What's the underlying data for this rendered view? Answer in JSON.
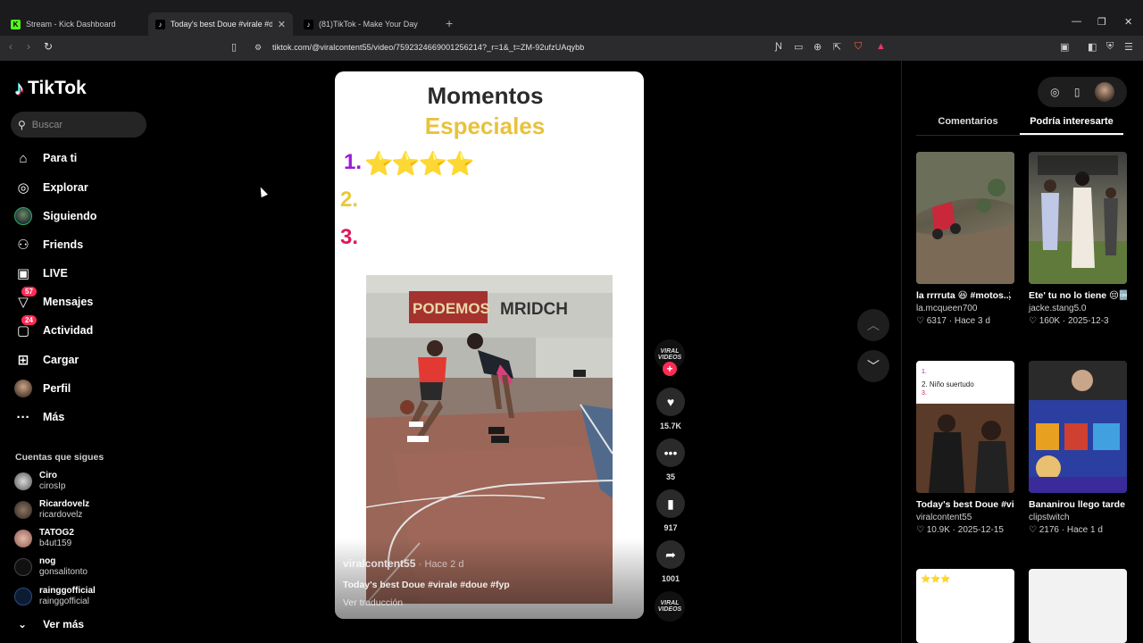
{
  "browser": {
    "tabs": [
      {
        "label": "Stream - Kick Dashboard",
        "icon": "K"
      },
      {
        "label": "Today's best Doue #virale #doue",
        "icon": "♪"
      },
      {
        "label": "(81)TikTok - Make Your Day",
        "icon": "♪"
      }
    ],
    "url": "tiktok.com/@viralcontent55/video/7592324669001256214?_r=1&_t=ZM-92ufzUAqybb"
  },
  "brand": {
    "name": "TikTok"
  },
  "search": {
    "placeholder": "Buscar"
  },
  "nav": [
    {
      "label": "Para ti",
      "icon": "home-icon"
    },
    {
      "label": "Explorar",
      "icon": "compass-icon"
    },
    {
      "label": "Siguiendo",
      "icon": "following-avatar"
    },
    {
      "label": "Friends",
      "icon": "friends-icon"
    },
    {
      "label": "LIVE",
      "icon": "live-icon"
    },
    {
      "label": "Mensajes",
      "icon": "message-icon",
      "badge": "57"
    },
    {
      "label": "Actividad",
      "icon": "activity-icon",
      "badge": "24"
    },
    {
      "label": "Cargar",
      "icon": "upload-icon"
    },
    {
      "label": "Perfil",
      "icon": "profile-avatar"
    },
    {
      "label": "Más",
      "icon": "more-icon"
    }
  ],
  "following": {
    "header": "Cuentas que sigues",
    "accounts": [
      {
        "name": "Ciro",
        "user": "cirosIp"
      },
      {
        "name": "Ricardovelz",
        "user": "ricardovelz"
      },
      {
        "name": "TATOG2",
        "user": "b4ut159"
      },
      {
        "name": "nog",
        "user": "gonsalitonto"
      },
      {
        "name": "rainggofficial",
        "user": "rainggofficial"
      }
    ],
    "more": "Ver más"
  },
  "video": {
    "title_line1": "Momentos",
    "title_line2": "Especiales",
    "ranks": [
      "1.",
      "2.",
      "3."
    ],
    "stars": "⭐⭐⭐⭐",
    "wall_text1": "PODEMOS",
    "wall_text2": "MRIDCH",
    "author": "viralcontent55",
    "time": "· Hace 2 d",
    "caption": "Today's best Doue #virale #doue #fyp",
    "translate": "Ver traducción"
  },
  "actions": {
    "creator_badge": "VIRAL VIDEOS",
    "likes": "15.7K",
    "comments": "35",
    "saves": "917",
    "shares": "1001"
  },
  "right_panel": {
    "tabs": [
      "Comentarios",
      "Podría interesarte"
    ],
    "cards": [
      {
        "title": "la rrrruta 😆 #motos...",
        "author": "la.mcqueen700",
        "likes": "6317",
        "date": "Hace 3 d"
      },
      {
        "title": "Ete' tu no lo tiene 😔🆒 (en realida...",
        "author": "jacke.stang5.0",
        "likes": "160K",
        "date": "2025-12-3"
      },
      {
        "title": "Today's best Doue #virale #doue...",
        "author": "viralcontent55",
        "likes": "10.9K",
        "date": "2025-12-15"
      },
      {
        "title": "Bananirou llego tarde y la gente s...",
        "author": "clipstwitch",
        "likes": "2176",
        "date": "Hace 1 d"
      }
    ],
    "card3_overlay": "2. Niño suertudo"
  },
  "colors": {
    "accent": "#fe2c55",
    "title_gold": "#e9c23a"
  }
}
